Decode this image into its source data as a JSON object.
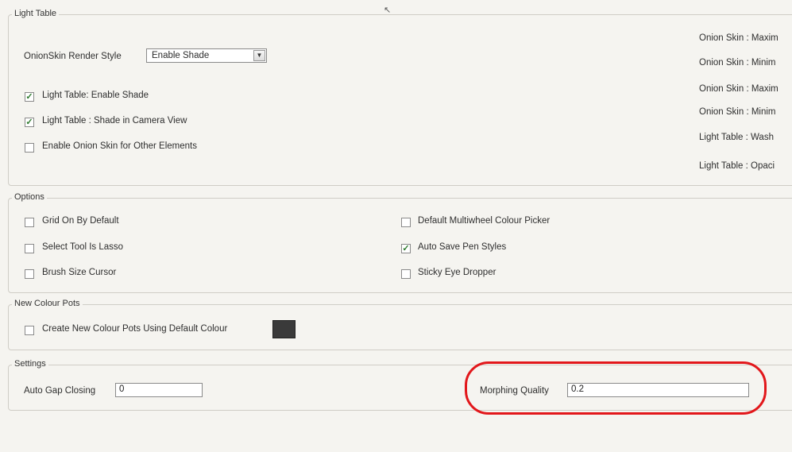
{
  "light_table": {
    "title": "Light Table",
    "render_style_label": "OnionSkin Render Style",
    "render_style_value": "Enable Shade",
    "enable_shade_label": "Light Table: Enable Shade",
    "enable_shade_checked": true,
    "camera_view_label": "Light Table : Shade in Camera View",
    "camera_view_checked": true,
    "onion_other_label": "Enable Onion Skin for Other Elements",
    "onion_other_checked": false,
    "right_labels": [
      "Onion Skin : Maxim",
      "Onion Skin : Minim",
      "Onion Skin : Maxim",
      "Onion Skin : Minim",
      "Light Table : Wash",
      "Light Table : Opaci"
    ]
  },
  "options": {
    "title": "Options",
    "grid_label": "Grid On By Default",
    "grid_checked": false,
    "select_lasso_label": "Select Tool Is Lasso",
    "select_lasso_checked": false,
    "brush_cursor_label": "Brush Size Cursor",
    "brush_cursor_checked": false,
    "multiwheel_label": "Default Multiwheel Colour Picker",
    "multiwheel_checked": false,
    "autosave_label": "Auto Save Pen Styles",
    "autosave_checked": true,
    "sticky_label": "Sticky Eye Dropper",
    "sticky_checked": false
  },
  "colour_pots": {
    "title": "New Colour Pots",
    "default_colour_label": "Create New Colour Pots Using Default Colour",
    "default_colour_checked": false,
    "swatch_color": "#3a3a3a"
  },
  "settings": {
    "title": "Settings",
    "auto_gap_label": "Auto Gap Closing",
    "auto_gap_value": "0",
    "morphing_label": "Morphing Quality",
    "morphing_value": "0.2"
  },
  "colors": {
    "highlight": "#e2171b",
    "check": "#2d7a2d"
  }
}
